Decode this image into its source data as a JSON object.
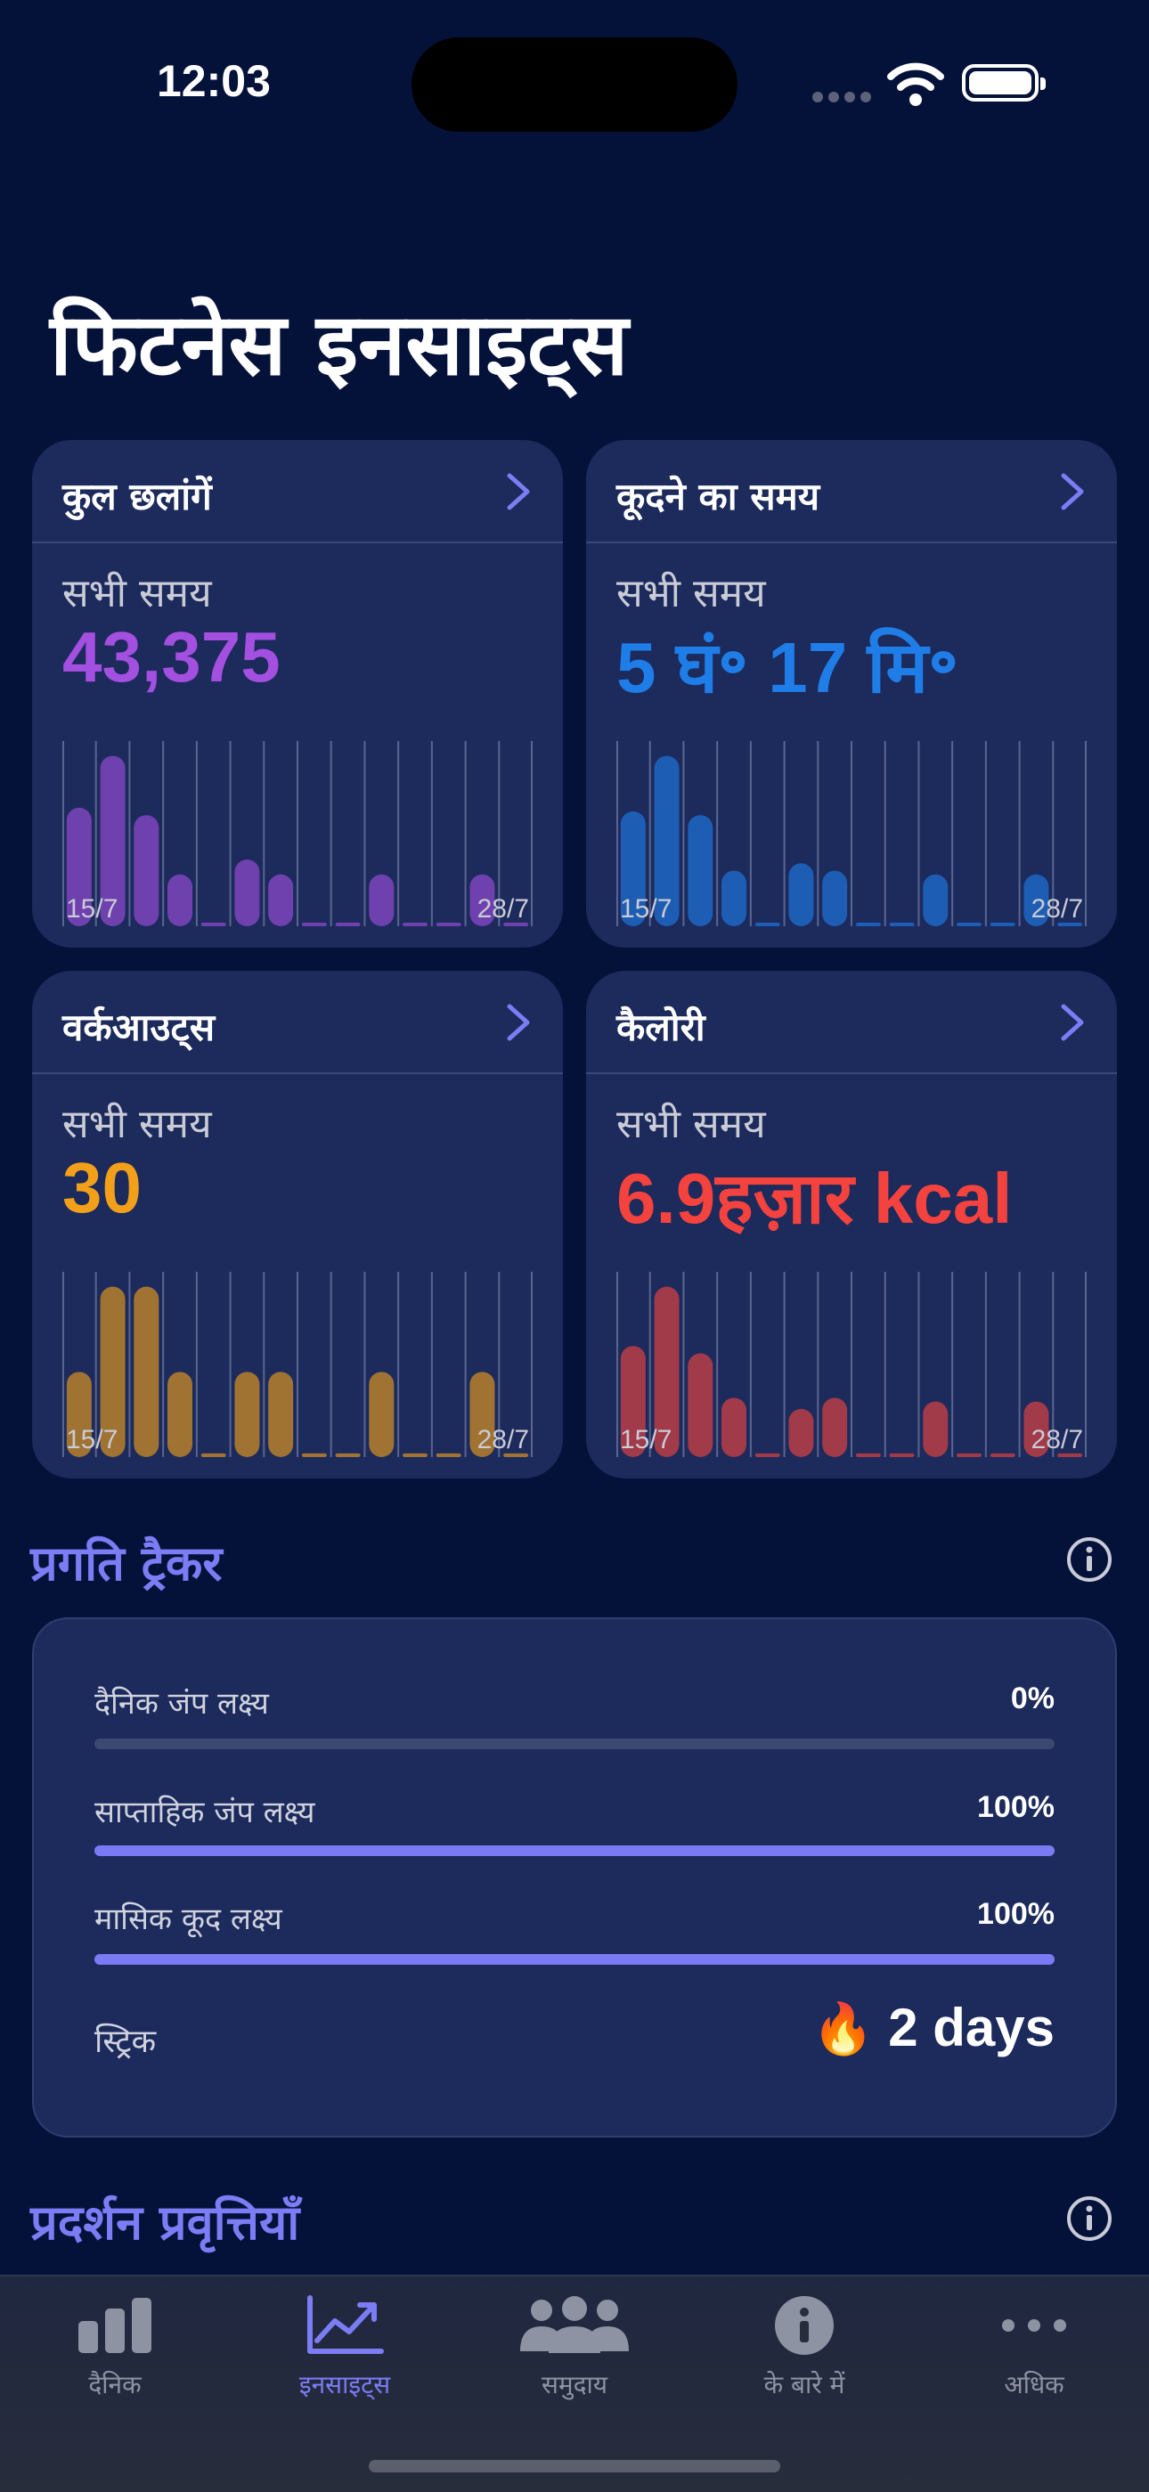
{
  "status": {
    "time": "12:03"
  },
  "page": {
    "title": "फिटनेस इनसाइट्स"
  },
  "cards": [
    {
      "title": "कुल छलांगें",
      "subtitle": "सभी समय",
      "value": "43,375",
      "color": "#a34fe0",
      "bars": [
        0.64,
        0.92,
        0.6,
        0.28,
        0.02,
        0.36,
        0.28,
        0.02,
        0.02,
        0.28,
        0.02,
        0.02,
        0.28,
        0.02
      ],
      "start": "15/7",
      "end": "28/7"
    },
    {
      "title": "कूदने का समय",
      "subtitle": "सभी समय",
      "value": "5 घं॰ 17 मि॰",
      "color": "#1f7de8",
      "bars": [
        0.62,
        0.92,
        0.6,
        0.3,
        0.02,
        0.34,
        0.3,
        0.02,
        0.02,
        0.28,
        0.02,
        0.02,
        0.28,
        0.02
      ],
      "start": "15/7",
      "end": "28/7"
    },
    {
      "title": "वर्कआउट्स",
      "subtitle": "सभी समय",
      "value": "30",
      "color": "#f2a019",
      "bars": [
        0.46,
        0.92,
        0.92,
        0.46,
        0.02,
        0.46,
        0.46,
        0.02,
        0.02,
        0.46,
        0.02,
        0.02,
        0.46,
        0.02
      ],
      "start": "15/7",
      "end": "28/7"
    },
    {
      "title": "कैलोरी",
      "subtitle": "सभी समय",
      "value": "6.9हज़ार kcal",
      "color": "#f4433e",
      "bars": [
        0.6,
        0.92,
        0.56,
        0.32,
        0.02,
        0.26,
        0.32,
        0.02,
        0.02,
        0.3,
        0.02,
        0.02,
        0.3,
        0.02
      ],
      "start": "15/7",
      "end": "28/7"
    }
  ],
  "tracker": {
    "title": "प्रगति ट्रैकर",
    "goals": [
      {
        "label": "दैनिक जंप लक्ष्य",
        "percent_text": "0%",
        "progress": 0
      },
      {
        "label": "साप्ताहिक जंप लक्ष्य",
        "percent_text": "100%",
        "progress": 1
      },
      {
        "label": "मासिक कूद लक्ष्य",
        "percent_text": "100%",
        "progress": 1
      }
    ],
    "streak_label": "स्ट्रिक",
    "streak_icon": "🔥",
    "streak_value": "2 days"
  },
  "trends": {
    "title": "प्रदर्शन प्रवृत्तियाँ"
  },
  "tabs": [
    {
      "label": "दैनिक",
      "icon": "bar-chart-icon",
      "active": false
    },
    {
      "label": "इनसाइट्स",
      "icon": "line-chart-icon",
      "active": true
    },
    {
      "label": "समुदाय",
      "icon": "people-icon",
      "active": false
    },
    {
      "label": "के बारे में",
      "icon": "info-icon",
      "active": false
    },
    {
      "label": "अधिक",
      "icon": "more-icon",
      "active": false
    }
  ],
  "colors": {
    "accent": "#7c7cf4",
    "background": "#04123a",
    "card": "#1c2a5c"
  }
}
